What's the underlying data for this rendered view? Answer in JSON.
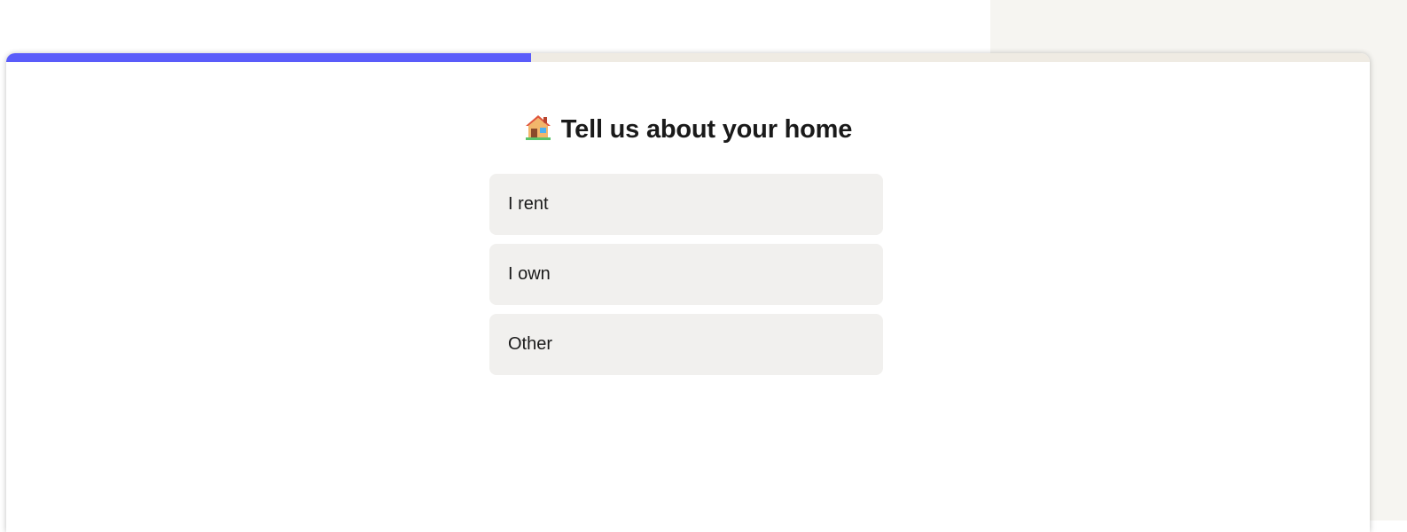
{
  "onboarding": {
    "progress_fraction": 0.385,
    "accent_color": "#5a5cfa",
    "question": {
      "icon": "house-icon",
      "title": "Tell us about your home"
    },
    "options": [
      {
        "label": "I rent"
      },
      {
        "label": "I own"
      },
      {
        "label": "Other"
      }
    ]
  }
}
